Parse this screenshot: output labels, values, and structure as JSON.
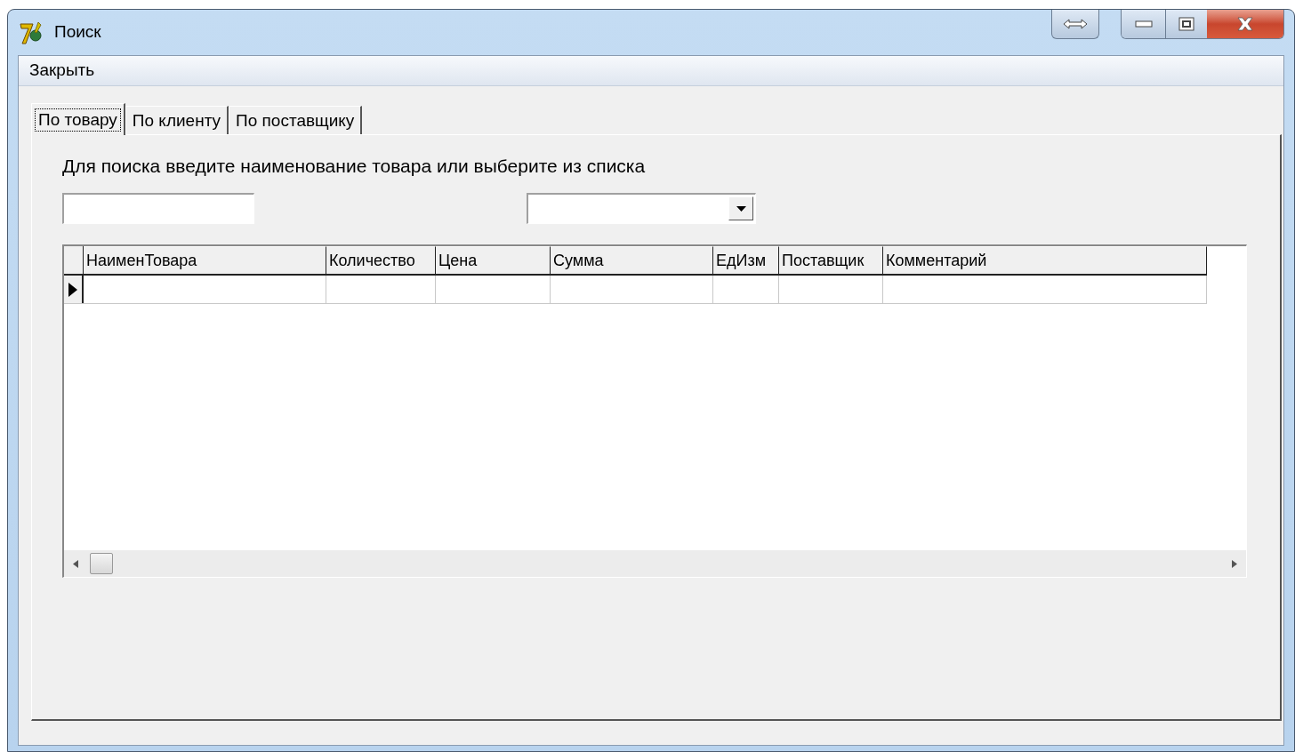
{
  "window": {
    "title": "Поиск"
  },
  "menu": [
    "Закрыть"
  ],
  "tabs": [
    {
      "label": "По товару",
      "selected": true
    },
    {
      "label": "По клиенту",
      "selected": false
    },
    {
      "label": "По поставщику",
      "selected": false
    }
  ],
  "instruction": "Для поиска введите наименование товара или выберите из списка",
  "grid": {
    "columns": [
      "НаименТовара",
      "Количество",
      "Цена",
      "Сумма",
      "ЕдИзм",
      "Поставщик",
      "Комментарий"
    ],
    "rows": [
      {
        "current": true
      }
    ]
  }
}
